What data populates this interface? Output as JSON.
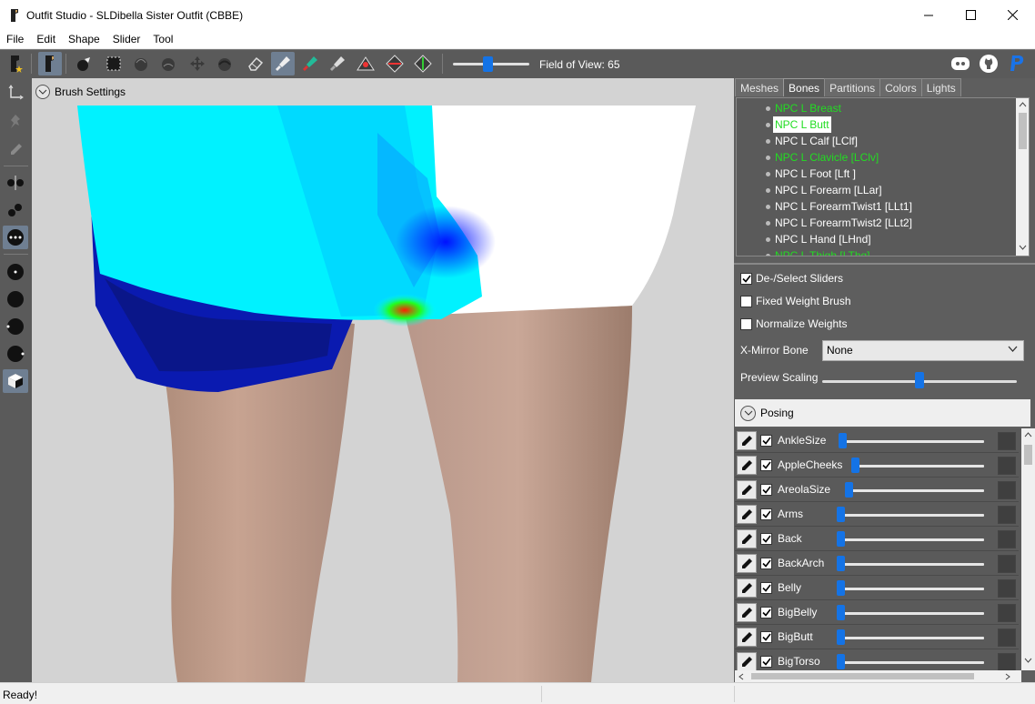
{
  "window": {
    "title": "Outfit Studio - SLDibella Sister Outfit (CBBE)",
    "controls": [
      "minimize-icon",
      "maximize-icon",
      "close-icon"
    ]
  },
  "menu": [
    "File",
    "Edit",
    "Shape",
    "Slider",
    "Tool"
  ],
  "toolbar": {
    "fov_label": "Field of View: 65",
    "fov_level": 0.45,
    "brand_icons": [
      "discord-icon",
      "github-icon",
      "paypal-icon"
    ]
  },
  "viewport": {
    "brush_settings_label": "Brush Settings"
  },
  "panel": {
    "tabs": [
      "Meshes",
      "Bones",
      "Partitions",
      "Colors",
      "Lights"
    ],
    "active_tab": "Bones",
    "bones": [
      {
        "label": "NPC L Breast",
        "state": "green"
      },
      {
        "label": "NPC L Butt",
        "state": "selected"
      },
      {
        "label": "NPC L Calf [LClf]",
        "state": "normal"
      },
      {
        "label": "NPC L Clavicle [LClv]",
        "state": "green"
      },
      {
        "label": "NPC L Foot [Lft ]",
        "state": "normal"
      },
      {
        "label": "NPC L Forearm [LLar]",
        "state": "normal"
      },
      {
        "label": "NPC L ForearmTwist1 [LLt1]",
        "state": "normal"
      },
      {
        "label": "NPC L ForearmTwist2 [LLt2]",
        "state": "normal"
      },
      {
        "label": "NPC L Hand [LHnd]",
        "state": "normal"
      },
      {
        "label": "NPC L Thigh [LThg]",
        "state": "green"
      }
    ],
    "options": {
      "deselect_sliders": {
        "label": "De-/Select Sliders",
        "checked": true
      },
      "fixed_weight_brush": {
        "label": "Fixed Weight Brush",
        "checked": false
      },
      "normalize_weights": {
        "label": "Normalize Weights",
        "checked": false
      },
      "xmirror_label": "X-Mirror Bone",
      "xmirror_value": "None",
      "preview_scaling_label": "Preview Scaling",
      "preview_scaling_level": 0.5
    },
    "posing_label": "Posing",
    "sliders": [
      {
        "name": "AnkleSize",
        "checked": true,
        "level": 0.0
      },
      {
        "name": "AppleCheeks",
        "checked": true,
        "level": 0.0
      },
      {
        "name": "AreolaSize",
        "checked": true,
        "level": 0.0
      },
      {
        "name": "Arms",
        "checked": true,
        "level": 0.0
      },
      {
        "name": "Back",
        "checked": true,
        "level": 0.0
      },
      {
        "name": "BackArch",
        "checked": true,
        "level": 0.0
      },
      {
        "name": "Belly",
        "checked": true,
        "level": 0.0
      },
      {
        "name": "BigBelly",
        "checked": true,
        "level": 0.0
      },
      {
        "name": "BigButt",
        "checked": true,
        "level": 0.0
      },
      {
        "name": "BigTorso",
        "checked": true,
        "level": 0.0
      }
    ]
  },
  "status": {
    "text": "Ready!"
  },
  "colors": {
    "accent": "#1473e6",
    "panel_bg": "#5a5a5a",
    "bone_green": "#22dd22"
  }
}
